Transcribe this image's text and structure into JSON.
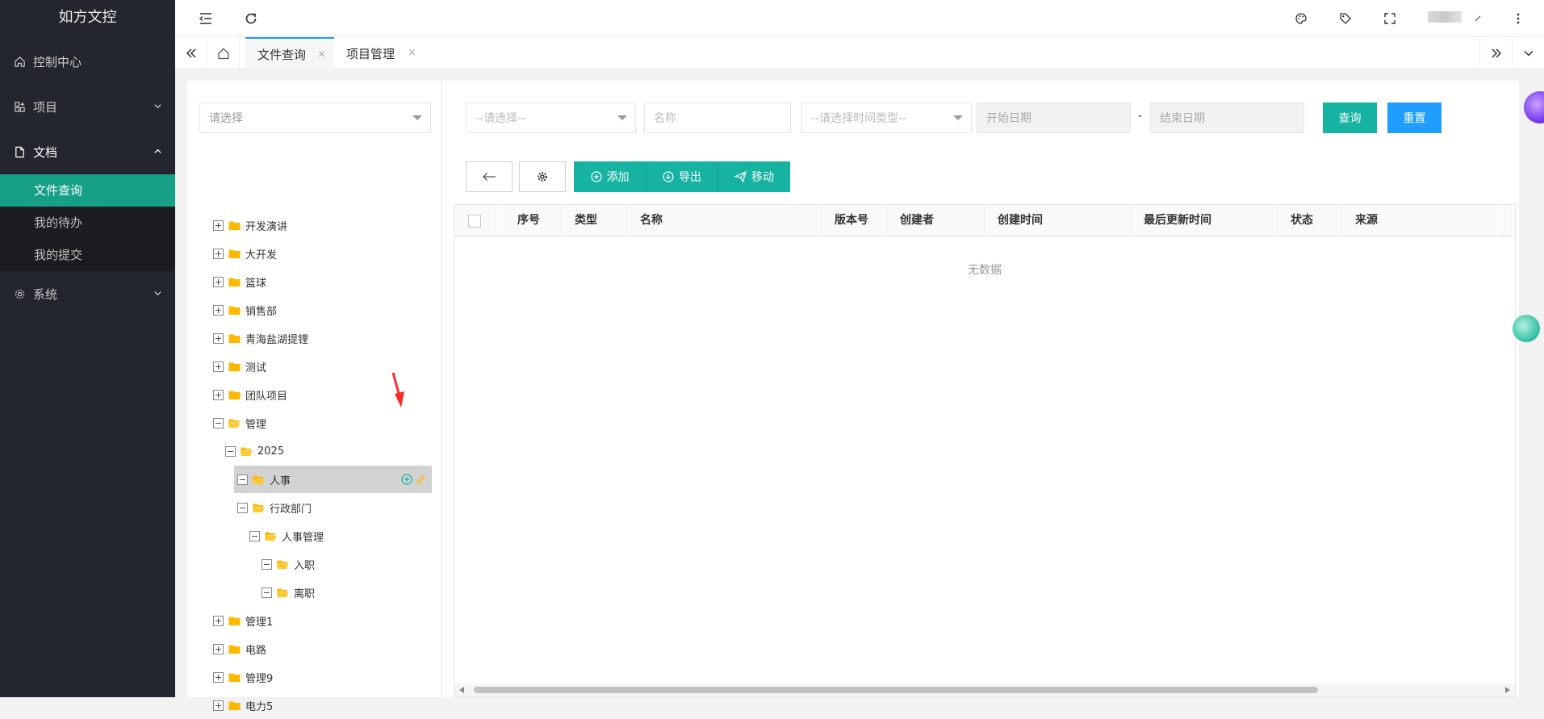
{
  "app": {
    "title": "如方文控"
  },
  "sidebar": {
    "items": [
      {
        "label": "控制中心",
        "icon": "home-icon"
      },
      {
        "label": "项目",
        "icon": "apps-icon"
      },
      {
        "label": "文档",
        "icon": "document-icon",
        "sub": [
          {
            "label": "文件查询",
            "active": true
          },
          {
            "label": "我的待办"
          },
          {
            "label": "我的提交"
          }
        ]
      },
      {
        "label": "系统",
        "icon": "gear-icon"
      }
    ]
  },
  "tabs": [
    {
      "label": "文件查询",
      "active": true,
      "close": "×"
    },
    {
      "label": "项目管理",
      "close": "×"
    }
  ],
  "tree": {
    "select_placeholder": "请选择",
    "nodes": [
      {
        "label": "开发演讲",
        "level": 0
      },
      {
        "label": "大开发",
        "level": 0
      },
      {
        "label": "篮球",
        "level": 0
      },
      {
        "label": "销售部",
        "level": 0
      },
      {
        "label": "青海盐湖提锂",
        "level": 0
      },
      {
        "label": "测试",
        "level": 0
      },
      {
        "label": "团队项目",
        "level": 0
      },
      {
        "label": "管理",
        "level": 0,
        "expanded": true
      },
      {
        "label": "2025",
        "level": 1,
        "expanded": true
      },
      {
        "label": "人事",
        "level": 2,
        "expanded": true,
        "selected": true
      },
      {
        "label": "行政部门",
        "level": 2,
        "expanded": true
      },
      {
        "label": "人事管理",
        "level": 3,
        "expanded": true
      },
      {
        "label": "入职",
        "level": 4,
        "expanded": true
      },
      {
        "label": "离职",
        "level": 4,
        "expanded": true
      },
      {
        "label": "管理1",
        "level": 0
      },
      {
        "label": "电路",
        "level": 0
      },
      {
        "label": "管理9",
        "level": 0
      },
      {
        "label": "电力5",
        "level": 0
      }
    ]
  },
  "filters": {
    "category_placeholder": "--请选择--",
    "name_placeholder": "名称",
    "time_type_placeholder": "--请选择时间类型--",
    "start_date_placeholder": "开始日期",
    "date_separator": "-",
    "end_date_placeholder": "结束日期",
    "search_label": "查询",
    "reset_label": "重置"
  },
  "toolbar": {
    "add_label": "添加",
    "export_label": "导出",
    "move_label": "移动"
  },
  "table": {
    "columns": [
      "序号",
      "类型",
      "名称",
      "版本号",
      "创建者",
      "创建时间",
      "最后更新时间",
      "状态",
      "来源"
    ],
    "empty_text": "无数据"
  },
  "colors": {
    "sidebar": "#23262e",
    "accent": "#16a085",
    "primary_button": "#16b3a2",
    "secondary_button": "#1e9fff",
    "folder": "#ffb800"
  }
}
